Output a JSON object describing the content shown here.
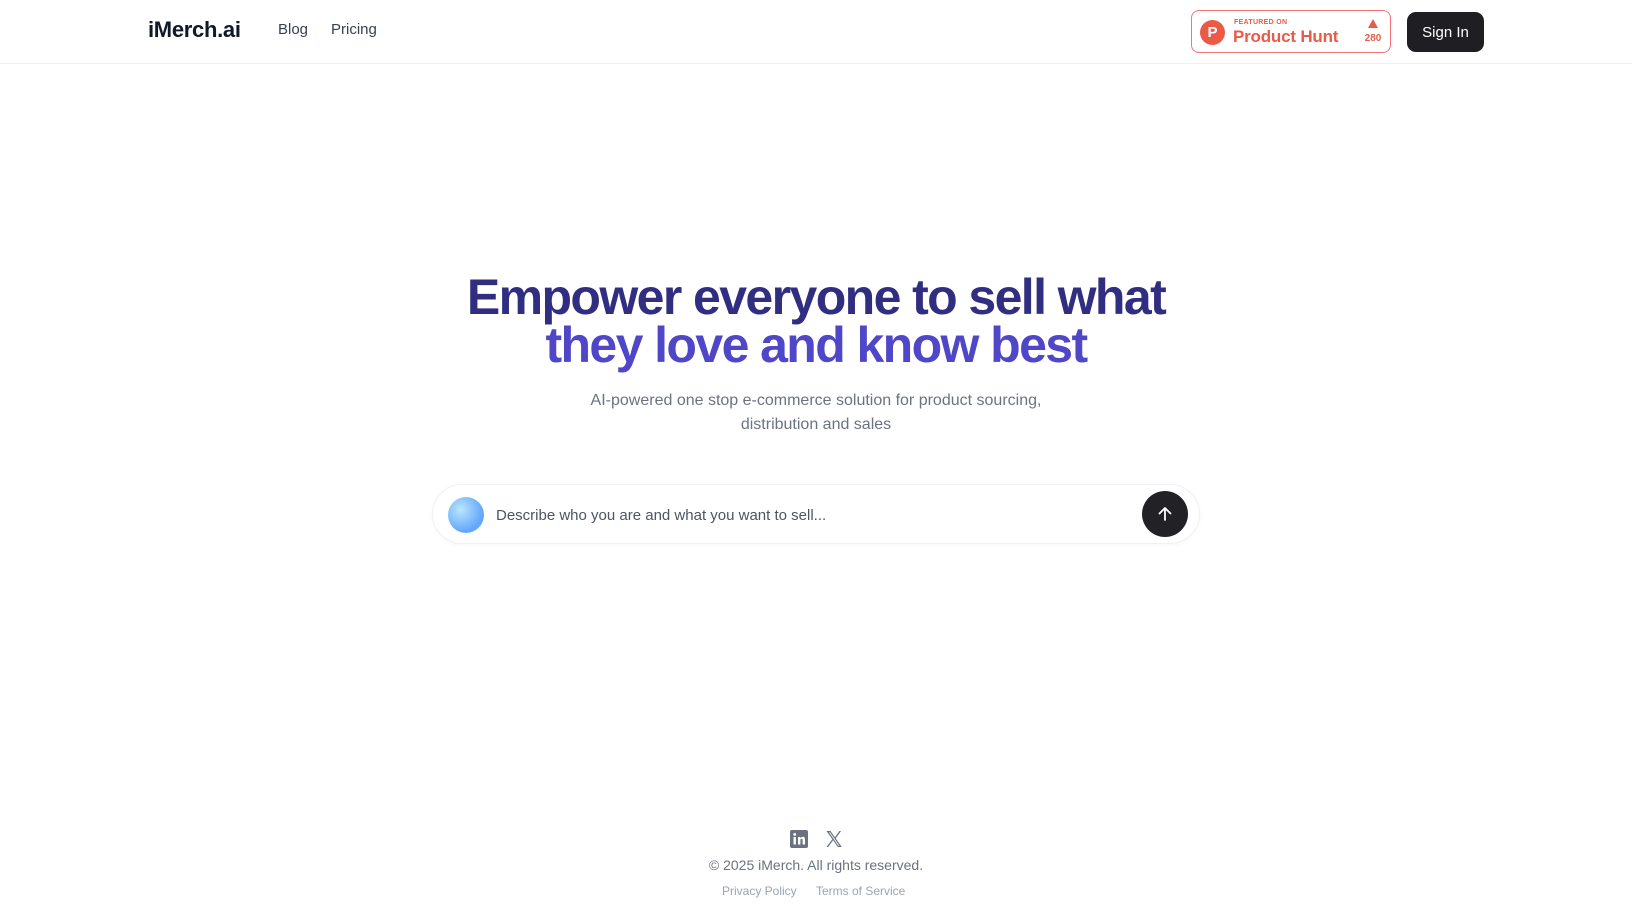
{
  "header": {
    "logo": "iMerch.ai",
    "nav": [
      {
        "label": "Blog"
      },
      {
        "label": "Pricing"
      }
    ],
    "product_hunt": {
      "featured_label": "FEATURED ON",
      "name": "Product Hunt",
      "count": "280"
    },
    "signin_label": "Sign In"
  },
  "hero": {
    "title_line1": "Empower everyone to sell what",
    "title_line2": "they love and know best",
    "subtitle": "AI-powered one stop e-commerce solution for product sourcing, distribution and sales"
  },
  "prompt": {
    "placeholder": "Describe who you are and what you want to sell..."
  },
  "footer": {
    "copyright": "© 2025 iMerch. All rights reserved.",
    "privacy": "Privacy Policy",
    "terms": "Terms of Service"
  },
  "colors": {
    "title_dark": "#312e81",
    "title_light": "#4f46c8",
    "product_hunt": "#ea5a47",
    "button_dark": "#1f1f23"
  }
}
